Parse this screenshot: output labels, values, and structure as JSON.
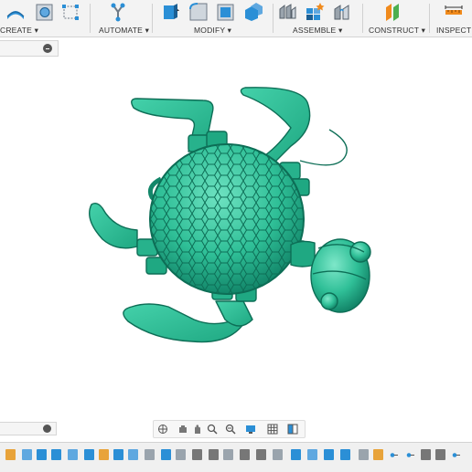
{
  "ribbon": {
    "groups": [
      {
        "label": "CREATE ▾"
      },
      {
        "label": "AUTOMATE ▾"
      },
      {
        "label": "MODIFY ▾"
      },
      {
        "label": "ASSEMBLE ▾"
      },
      {
        "label": "CONSTRUCT ▾"
      },
      {
        "label": "INSPECT ▾"
      }
    ]
  },
  "icons": {
    "create": [
      "extrude-icon",
      "revolve-icon",
      "sketch-box-icon"
    ],
    "automate": [
      "automate-icon"
    ],
    "modify": [
      "press-pull-icon",
      "fillet-icon",
      "shell-icon",
      "combine-icon"
    ],
    "assemble": [
      "joint-icon",
      "new-component-icon",
      "as-built-joint-icon"
    ],
    "construct": [
      "offset-plane-icon"
    ],
    "inspect": [
      "measure-icon"
    ],
    "navbar": [
      "orbit-icon",
      "look-at-icon",
      "pan-icon",
      "zoom-icon",
      "zoom-window-icon",
      "display-settings-icon",
      "grid-icon",
      "viewports-icon"
    ]
  },
  "colors": {
    "model": "#2fbf97",
    "model_dark": "#0f7d62",
    "ribbon_blue": "#2b8fd6",
    "accent_orange": "#f08a1c"
  }
}
